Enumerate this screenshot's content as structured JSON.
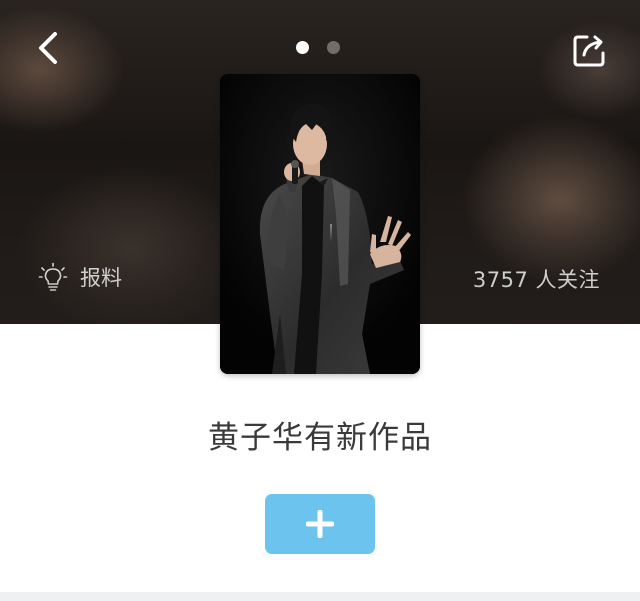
{
  "header": {
    "back_icon": "chevron-left-icon",
    "share_icon": "share-icon",
    "pager": {
      "count": 2,
      "active_index": 0
    }
  },
  "hero": {
    "tip_icon": "lightbulb-icon",
    "tip_label": "报料",
    "followers_text": "3757 人关注"
  },
  "topic": {
    "title": "黄子华有新作品"
  },
  "actions": {
    "follow_icon": "plus-icon",
    "accent_color": "#6cc4ee"
  }
}
